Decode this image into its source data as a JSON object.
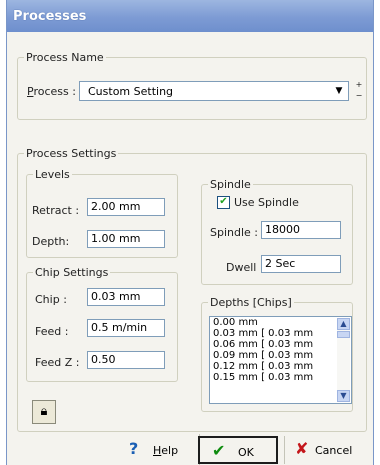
{
  "window": {
    "title": "Processes"
  },
  "process_name": {
    "legend": "Process Name",
    "process_label_prefix": "P",
    "process_label_rest": "rocess :",
    "selected_process": "Custom Setting"
  },
  "process_settings": {
    "legend": "Process Settings",
    "levels": {
      "legend": "Levels",
      "retract_label": "Retract :",
      "retract_value": "2.00 mm",
      "depth_label": "Depth:",
      "depth_value": "1.00 mm"
    },
    "chip_settings": {
      "legend": "Chip Settings",
      "chip_label": "Chip :",
      "chip_value": "0.03 mm",
      "feed_label": "Feed :",
      "feed_value": "0.5 m/min",
      "feedz_label": "Feed Z :",
      "feedz_value": "0.50"
    },
    "spindle": {
      "legend": "Spindle",
      "use_spindle_label": "Use Spindle",
      "use_spindle_checked": true,
      "spindle_label": "Spindle :",
      "spindle_value": "18000",
      "dwell_label": "Dwell :",
      "dwell_value": "2 Sec"
    },
    "depths": {
      "legend": "Depths [Chips]",
      "rows": [
        "0.00 mm",
        "0.03 mm  [ 0.03 mm",
        "0.06 mm  [ 0.03 mm",
        "0.09 mm  [ 0.03 mm",
        "0.12 mm  [ 0.03 mm",
        "0.15 mm  [ 0.03 mm"
      ]
    }
  },
  "buttons": {
    "help_prefix": "H",
    "help_rest": "elp",
    "ok": "OK",
    "cancel": "Cancel"
  },
  "icons": {
    "lock": "lock-icon",
    "help": "question-icon",
    "ok": "checkmark-icon",
    "cancel": "x-icon"
  }
}
